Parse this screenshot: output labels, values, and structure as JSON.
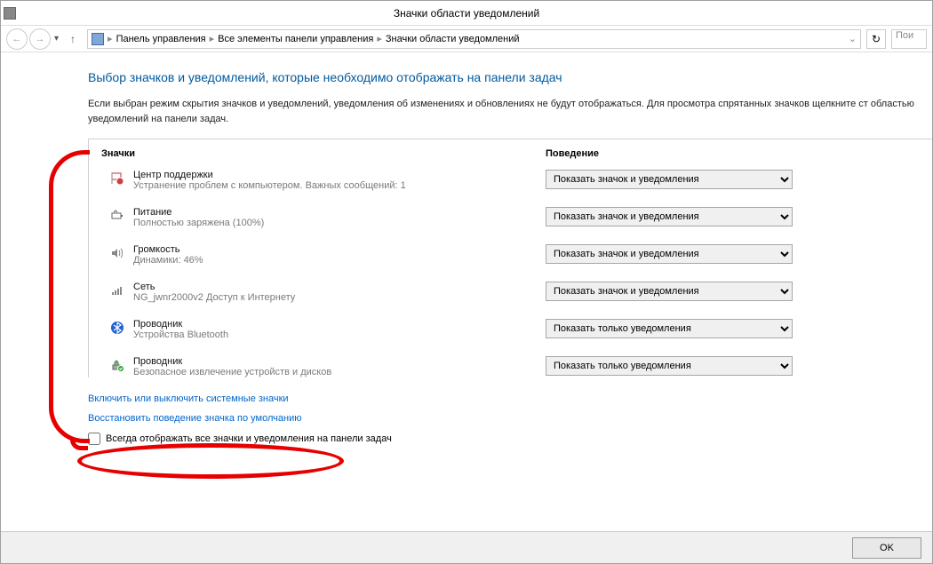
{
  "window": {
    "title": "Значки области уведомлений"
  },
  "breadcrumb": {
    "root": "Панель управления",
    "mid": "Все элементы панели управления",
    "leaf": "Значки области уведомлений"
  },
  "search": {
    "placeholder": "Пои"
  },
  "page": {
    "heading": "Выбор значков и уведомлений, которые необходимо отображать на панели задач",
    "desc": "Если выбран режим скрытия значков и уведомлений, уведомления об изменениях и обновлениях не будут отображаться. Для просмотра спрятанных значков щелкните ст областью уведомлений на панели задач."
  },
  "columns": {
    "icons": "Значки",
    "behavior": "Поведение"
  },
  "dropdown_options": {
    "show_all": "Показать значок и уведомления",
    "notif_only": "Показать только уведомления"
  },
  "items": [
    {
      "icon": "flag",
      "name": "Центр поддержки",
      "detail": "Устранение проблем с компьютером. Важных сообщений: 1",
      "selected": "show_all"
    },
    {
      "icon": "battery",
      "name": "Питание",
      "detail": "Полностью заряжена (100%)",
      "selected": "show_all"
    },
    {
      "icon": "volume",
      "name": "Громкость",
      "detail": "Динамики: 46%",
      "selected": "show_all"
    },
    {
      "icon": "network",
      "name": "Сеть",
      "detail": "NG_jwnr2000v2 Доступ к Интернету",
      "selected": "show_all"
    },
    {
      "icon": "bluetooth",
      "name": "Проводник",
      "detail": "Устройства Bluetooth",
      "selected": "notif_only"
    },
    {
      "icon": "eject",
      "name": "Проводник",
      "detail": "Безопасное извлечение устройств и дисков",
      "selected": "notif_only"
    }
  ],
  "links": {
    "toggle_system": "Включить или выключить системные значки",
    "restore_default": "Восстановить поведение значка по умолчанию"
  },
  "checkbox": {
    "label": "Всегда отображать все значки и уведомления на панели задач",
    "checked": false
  },
  "buttons": {
    "ok": "OK"
  }
}
